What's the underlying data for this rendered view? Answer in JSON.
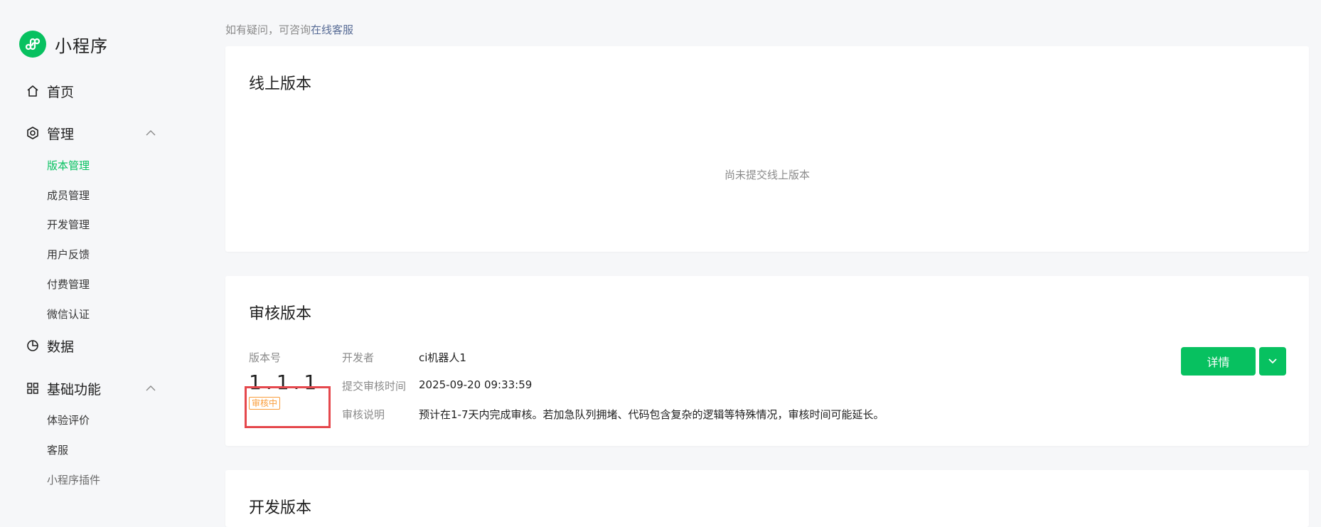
{
  "brand": {
    "name": "小程序",
    "color": "#07c160"
  },
  "sidebar": {
    "groups": [
      {
        "label": "首页",
        "icon": "home-icon"
      },
      {
        "label": "管理",
        "icon": "settings-hex-icon",
        "expanded": true,
        "items": [
          "版本管理",
          "成员管理",
          "开发管理",
          "用户反馈",
          "付费管理",
          "微信认证"
        ]
      },
      {
        "label": "数据",
        "icon": "pie-chart-icon"
      },
      {
        "label": "基础功能",
        "icon": "grid-icon",
        "expanded": true,
        "items": [
          "体验评价",
          "客服",
          "小程序插件"
        ]
      }
    ],
    "active_item": "版本管理"
  },
  "help": {
    "prefix": "如有疑问，可咨询",
    "link": "在线客服"
  },
  "online_version": {
    "title": "线上版本",
    "empty_text": "尚未提交线上版本"
  },
  "review_version": {
    "title": "审核版本",
    "version_label": "版本号",
    "version_number": "1.1.1",
    "status": "审核中",
    "fields": [
      {
        "label": "开发者",
        "value": "ci机器人1"
      },
      {
        "label": "提交审核时间",
        "value": "2025-09-20 09:33:59"
      },
      {
        "label": "审核说明",
        "value": "预计在1-7天内完成审核。若加急队列拥堵、代码包含复杂的逻辑等特殊情况，审核时间可能延长。"
      }
    ],
    "detail_button": "详情"
  },
  "dev_version": {
    "title": "开发版本"
  },
  "colors": {
    "accent": "#07c160",
    "warning": "#fa9d3b",
    "highlight": "#e5484d",
    "link": "#576b95"
  }
}
